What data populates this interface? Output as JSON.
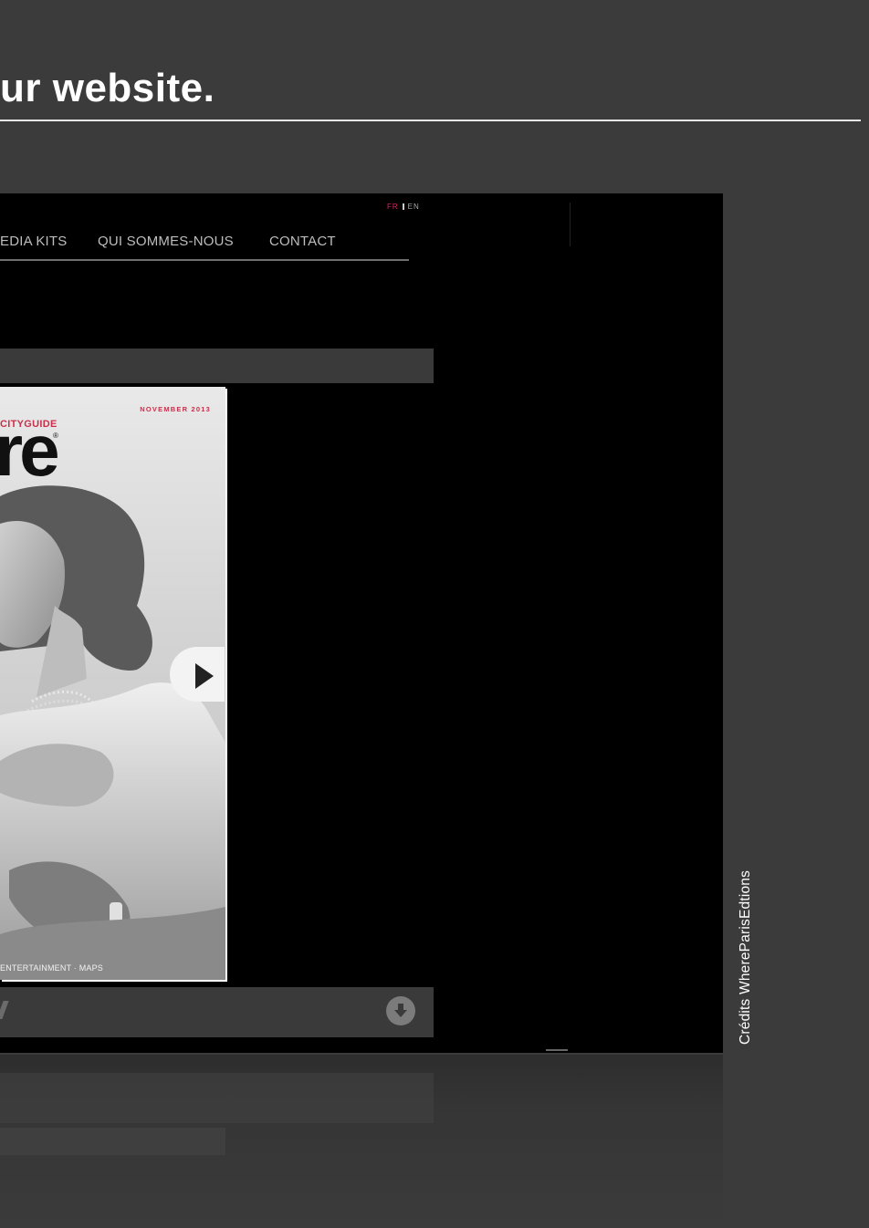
{
  "heading": "ur website.",
  "screenshot": {
    "language": {
      "fr": "FR",
      "en": "EN"
    },
    "nav": [
      {
        "label": "EDIA KITS"
      },
      {
        "label": "QUI SOMMES-NOUS"
      },
      {
        "label": "CONTACT"
      }
    ],
    "cover": {
      "issue": "NOVEMBER 2013",
      "brand": "CITYGUIDE",
      "logo": "re",
      "registered": "®",
      "footer": "ENTERTAINMENT · MAPS"
    },
    "icons": {
      "next": "next-arrow-icon",
      "download": "download-icon",
      "edit": "pen-icon"
    }
  },
  "credit": "Crédits WhereParisEdtions",
  "colors": {
    "background": "#3b3b3b",
    "accent": "#c9304b",
    "frame": "#000000"
  }
}
